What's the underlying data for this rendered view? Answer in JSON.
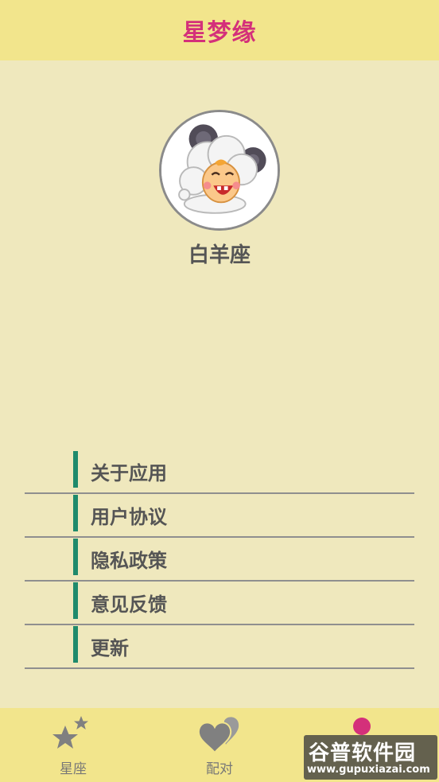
{
  "header": {
    "title": "星梦缘"
  },
  "profile": {
    "sign_name": "白羊座",
    "avatar_icon": "aries-sheep-cartoon"
  },
  "menu": {
    "items": [
      {
        "label": "关于应用"
      },
      {
        "label": "用户协议"
      },
      {
        "label": "隐私政策"
      },
      {
        "label": "意见反馈"
      },
      {
        "label": "更新"
      }
    ]
  },
  "tabbar": {
    "tabs": [
      {
        "label": "星座",
        "icon": "stars-icon"
      },
      {
        "label": "配对",
        "icon": "hearts-icon"
      }
    ]
  },
  "watermark": {
    "logo": "谷普软件园",
    "url": "www.gupuxiazai.com"
  },
  "colors": {
    "header_bg": "#f2e58c",
    "page_bg": "#efe8bd",
    "title": "#d4307a",
    "accent_bar": "#1f8a6c"
  }
}
